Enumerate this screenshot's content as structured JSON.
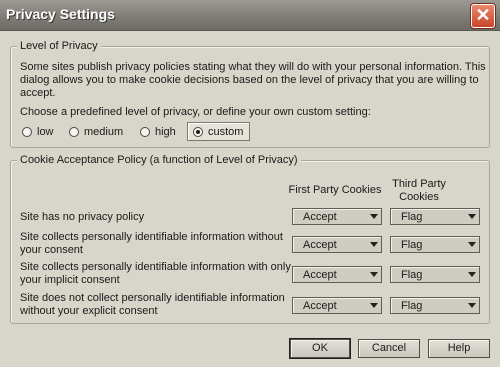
{
  "window": {
    "title": "Privacy Settings",
    "close_label": "✕"
  },
  "privacy_level": {
    "legend": "Level of Privacy",
    "description_line1": "Some sites publish privacy policies stating what they will do with your personal information. This",
    "description_line2": "dialog allows you to make cookie decisions based on the level of privacy that you are willing to",
    "description_line3": "accept.",
    "choose_label": "Choose a predefined level of privacy, or define your own custom setting:",
    "options": [
      "low",
      "medium",
      "high",
      "custom"
    ],
    "selected": "custom"
  },
  "cookie_policy": {
    "legend": "Cookie Acceptance Policy (a function of Level of Privacy)",
    "col_first_party": "First Party Cookies",
    "col_third_party_line1": "Third Party",
    "col_third_party_line2": "Cookies",
    "rows": [
      {
        "label_line1": "Site has no privacy policy",
        "label_line2": "",
        "first_party": "Accept",
        "third_party": "Flag"
      },
      {
        "label_line1": "Site collects personally identifiable information without",
        "label_line2": "your consent",
        "first_party": "Accept",
        "third_party": "Flag"
      },
      {
        "label_line1": "Site collects personally identifiable information with only",
        "label_line2": "your implicit consent",
        "first_party": "Accept",
        "third_party": "Flag"
      },
      {
        "label_line1": "Site does not collect personally identifiable information",
        "label_line2": "without your explicit consent",
        "first_party": "Accept",
        "third_party": "Flag"
      }
    ]
  },
  "buttons": {
    "ok": "OK",
    "cancel": "Cancel",
    "help": "Help"
  }
}
